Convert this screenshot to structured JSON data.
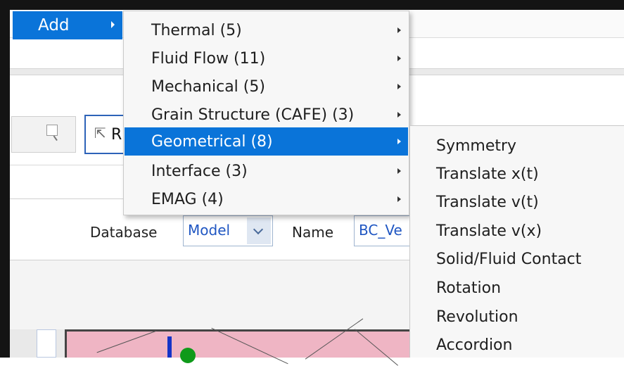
{
  "menubar": {
    "add_label": "Add"
  },
  "toolbar": {
    "select_prefix": "R"
  },
  "form": {
    "database_label": "Database",
    "database_value": "Model",
    "name_label": "Name",
    "name_value": "BC_Ve"
  },
  "add_submenu": {
    "items": [
      {
        "label": "Thermal (5)"
      },
      {
        "label": "Fluid Flow (11)"
      },
      {
        "label": "Mechanical (5)"
      },
      {
        "label": "Grain Structure (CAFE) (3)"
      },
      {
        "label": "Geometrical (8)"
      },
      {
        "label": "Interface (3)"
      },
      {
        "label": "EMAG (4)"
      }
    ],
    "highlighted": "Geometrical (8)"
  },
  "geometrical_submenu": {
    "items": [
      {
        "label": "Symmetry"
      },
      {
        "label": "Translate x(t)"
      },
      {
        "label": "Translate v(t)"
      },
      {
        "label": "Translate v(x)"
      },
      {
        "label": "Solid/Fluid Contact"
      },
      {
        "label": "Rotation"
      },
      {
        "label": "Revolution"
      },
      {
        "label": "Accordion"
      }
    ]
  },
  "colors": {
    "menu_highlight": "#0a74d9",
    "mesh_fill": "#efb5c4",
    "field_text": "#1f56c2"
  }
}
